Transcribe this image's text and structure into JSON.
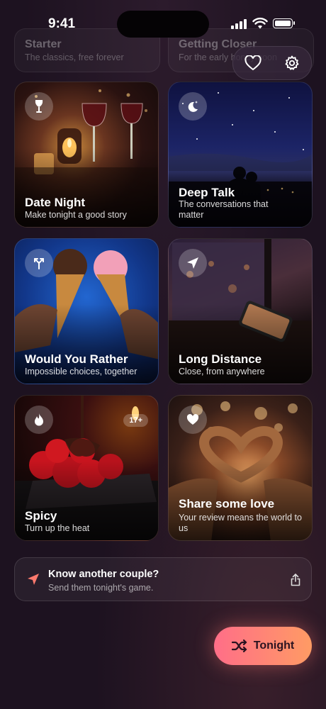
{
  "status_bar": {
    "time": "9:41"
  },
  "top_cards": [
    {
      "title": "Starter",
      "subtitle": "The classics, free forever"
    },
    {
      "title": "Getting Closer",
      "subtitle": "For the early honeymoon"
    }
  ],
  "header_actions": {
    "favorites_icon": "heart-icon",
    "settings_icon": "gear-icon"
  },
  "cards": [
    {
      "title": "Date Night",
      "subtitle": "Make tonight a good story",
      "icon": "wine-glass-icon"
    },
    {
      "title": "Deep Talk",
      "subtitle": "The conversations that matter",
      "icon": "moon-stars-icon"
    },
    {
      "title": "Would You Rather",
      "subtitle": "Impossible choices, together",
      "icon": "split-arrow-icon"
    },
    {
      "title": "Long Distance",
      "subtitle": "Close, from anywhere",
      "icon": "paper-plane-icon"
    },
    {
      "title": "Spicy",
      "subtitle": "Turn up the heat",
      "icon": "flame-icon",
      "badge": "17+"
    },
    {
      "title": "Share some love",
      "subtitle": "Your review means the world to us",
      "icon": "heart-icon"
    }
  ],
  "share": {
    "title": "Know another couple?",
    "subtitle": "Send them tonight's game."
  },
  "cta": {
    "label": "Tonight",
    "icon": "shuffle-icon"
  },
  "colors": {
    "background": "#1d1220",
    "accent_start": "#ff6e88",
    "accent_end": "#ff9b64"
  }
}
